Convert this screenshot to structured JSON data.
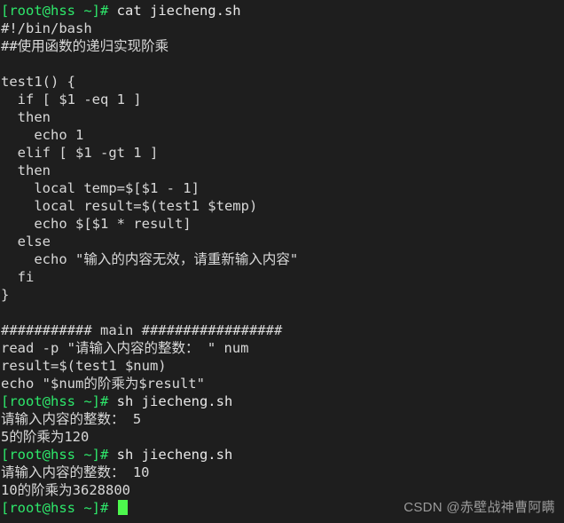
{
  "terminal": {
    "background_color": "#1e1e1e",
    "prompt_color": "#2ee86b",
    "text_color": "#d4d4d4",
    "cursor_color": "#4df84d",
    "prompt_string": "[root@hss ~]#",
    "lines": [
      {
        "type": "prompt",
        "prompt": "[root@hss ~]#",
        "command": " cat jiecheng.sh"
      },
      {
        "type": "out",
        "text": "#!/bin/bash"
      },
      {
        "type": "out",
        "text": "##使用函数的递归实现阶乘"
      },
      {
        "type": "blank",
        "text": ""
      },
      {
        "type": "out",
        "text": "test1() {"
      },
      {
        "type": "out",
        "text": "  if [ $1 -eq 1 ]"
      },
      {
        "type": "out",
        "text": "  then"
      },
      {
        "type": "out",
        "text": "    echo 1"
      },
      {
        "type": "out",
        "text": "  elif [ $1 -gt 1 ]"
      },
      {
        "type": "out",
        "text": "  then"
      },
      {
        "type": "out",
        "text": "    local temp=$[$1 - 1]"
      },
      {
        "type": "out",
        "text": "    local result=$(test1 $temp)"
      },
      {
        "type": "out",
        "text": "    echo $[$1 * result]"
      },
      {
        "type": "out",
        "text": "  else"
      },
      {
        "type": "out",
        "text": "    echo \"输入的内容无效，请重新输入内容\""
      },
      {
        "type": "out",
        "text": "  fi"
      },
      {
        "type": "out",
        "text": "}"
      },
      {
        "type": "blank",
        "text": ""
      },
      {
        "type": "out",
        "text": "########### main #################"
      },
      {
        "type": "out",
        "text": "read -p \"请输入内容的整数： \" num"
      },
      {
        "type": "out",
        "text": "result=$(test1 $num)"
      },
      {
        "type": "out",
        "text": "echo \"$num的阶乘为$result\""
      },
      {
        "type": "prompt",
        "prompt": "[root@hss ~]#",
        "command": " sh jiecheng.sh"
      },
      {
        "type": "out",
        "text": "请输入内容的整数： 5"
      },
      {
        "type": "out",
        "text": "5的阶乘为120"
      },
      {
        "type": "prompt",
        "prompt": "[root@hss ~]#",
        "command": " sh jiecheng.sh"
      },
      {
        "type": "out",
        "text": "请输入内容的整数： 10"
      },
      {
        "type": "out",
        "text": "10的阶乘为3628800"
      },
      {
        "type": "cursorline",
        "prompt": "[root@hss ~]#",
        "command": " "
      }
    ]
  },
  "watermark": {
    "text": "CSDN @赤壁战神曹阿瞒",
    "color": "#9b9b9b"
  }
}
